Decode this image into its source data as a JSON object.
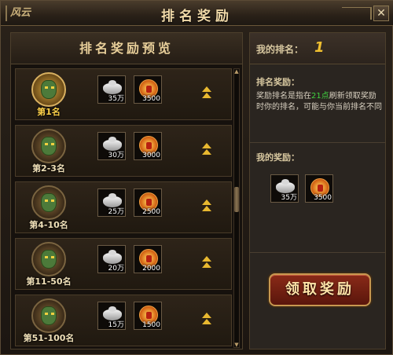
{
  "window": {
    "title": "排名奖励",
    "logo_text": "风云",
    "close_label": "✕"
  },
  "preview": {
    "title": "排名奖励预览",
    "rows": [
      {
        "rank": "第1名",
        "top": true,
        "silver": "35万",
        "medal": "3500"
      },
      {
        "rank": "第2-3名",
        "top": false,
        "silver": "30万",
        "medal": "3000"
      },
      {
        "rank": "第4-10名",
        "top": false,
        "silver": "25万",
        "medal": "2500"
      },
      {
        "rank": "第11-50名",
        "top": false,
        "silver": "20万",
        "medal": "2000"
      },
      {
        "rank": "第51-100名",
        "top": false,
        "silver": "15万",
        "medal": "1500"
      }
    ]
  },
  "my_rank": {
    "label": "我的排名：",
    "value": "1"
  },
  "rule": {
    "title": "排名奖励：",
    "text_before": "奖励排名是指在",
    "time": "21点",
    "text_after": "刷新领取奖励时你的排名，可能与你当前排名不同"
  },
  "my_reward": {
    "title": "我的奖励：",
    "silver": "35万",
    "medal": "3500"
  },
  "claim_button": "领取奖励",
  "icons": {
    "silver": "silver-ingot-icon",
    "medal": "honor-medal-icon",
    "expand": "double-chevron-up-icon"
  },
  "colors": {
    "accent": "#f0c030",
    "time_highlight": "#40d040",
    "button": "#8a2a18"
  }
}
